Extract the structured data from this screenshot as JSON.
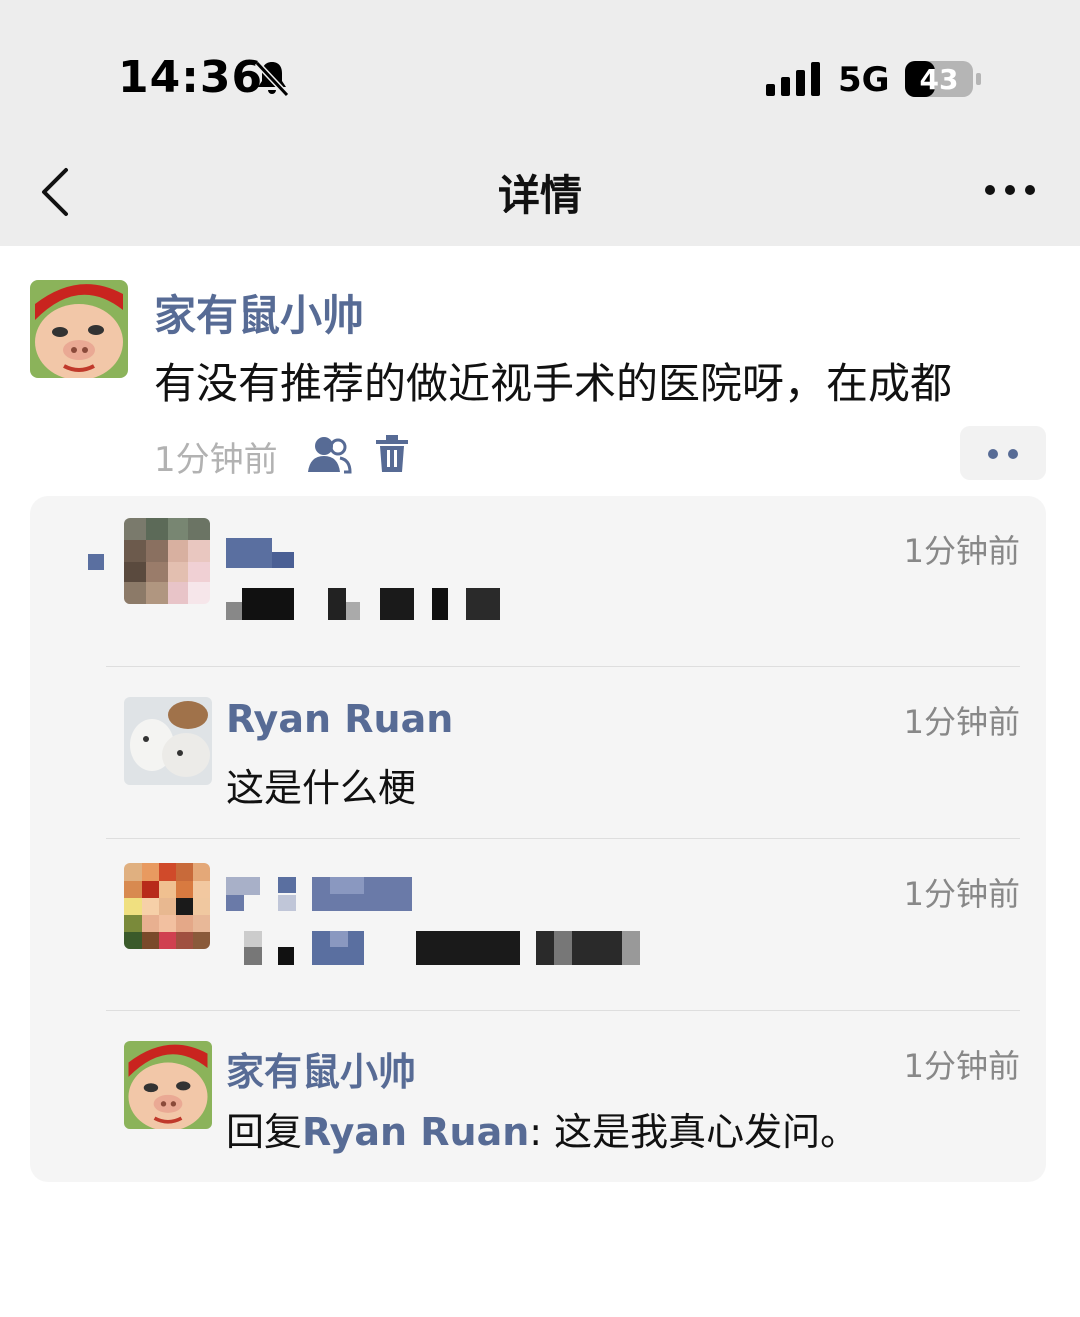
{
  "status_bar": {
    "time": "14:36",
    "network": "5G",
    "battery": "43"
  },
  "nav": {
    "title": "详情",
    "back_icon": "chevron-left-icon",
    "more_icon": "more-dots-icon"
  },
  "post": {
    "author": "家有鼠小帅",
    "text": "有没有推荐的做近视手术的医院呀，在成都",
    "time": "1分钟前"
  },
  "comments": [
    {
      "author": "",
      "text": "",
      "time": "1分钟前",
      "pixelated": true
    },
    {
      "author": "Ryan Ruan",
      "text": "这是什么梗",
      "time": "1分钟前"
    },
    {
      "author": "",
      "text": "",
      "time": "1分钟前",
      "pixelated": true
    },
    {
      "author": "家有鼠小帅",
      "reply_prefix": "回复",
      "reply_to": "Ryan Ruan",
      "text": ": 这是我真心发问。",
      "time": "1分钟前"
    }
  ],
  "colors": {
    "link": "#576b95",
    "topbar": "#ededed",
    "comment_bg": "#f5f5f5"
  }
}
